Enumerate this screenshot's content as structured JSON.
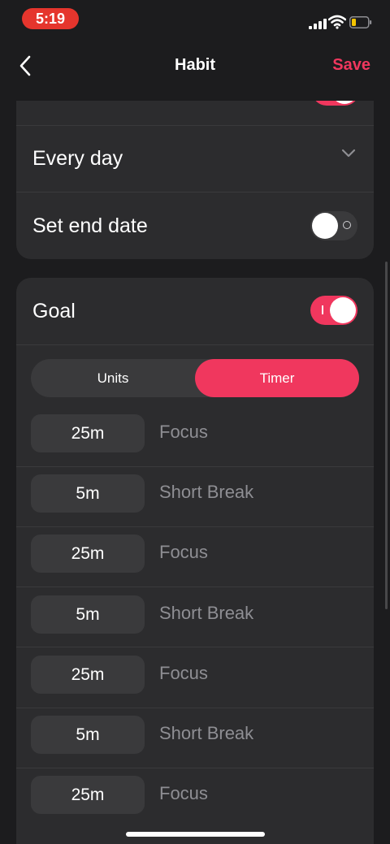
{
  "status_bar": {
    "time": "5:19"
  },
  "nav": {
    "title": "Habit",
    "save_label": "Save"
  },
  "repeat_card": {
    "frequency_label": "Every day",
    "end_date_label": "Set end date",
    "end_date_enabled": false
  },
  "goal_card": {
    "goal_label": "Goal",
    "goal_enabled": true,
    "segments": {
      "units_label": "Units",
      "timer_label": "Timer",
      "selected": "Timer"
    },
    "timer_items": [
      {
        "duration": "25m",
        "label": "Focus"
      },
      {
        "duration": "5m",
        "label": "Short Break"
      },
      {
        "duration": "25m",
        "label": "Focus"
      },
      {
        "duration": "5m",
        "label": "Short Break"
      },
      {
        "duration": "25m",
        "label": "Focus"
      },
      {
        "duration": "5m",
        "label": "Short Break"
      },
      {
        "duration": "25m",
        "label": "Focus"
      }
    ]
  },
  "colors": {
    "accent": "#f0375e",
    "background": "#1c1c1e",
    "card": "#2c2c2e",
    "status_time_bg": "#e5352d"
  },
  "icons": [
    "back-chevron-icon",
    "chevron-down-icon",
    "signal-icon",
    "wifi-icon",
    "battery-icon"
  ]
}
